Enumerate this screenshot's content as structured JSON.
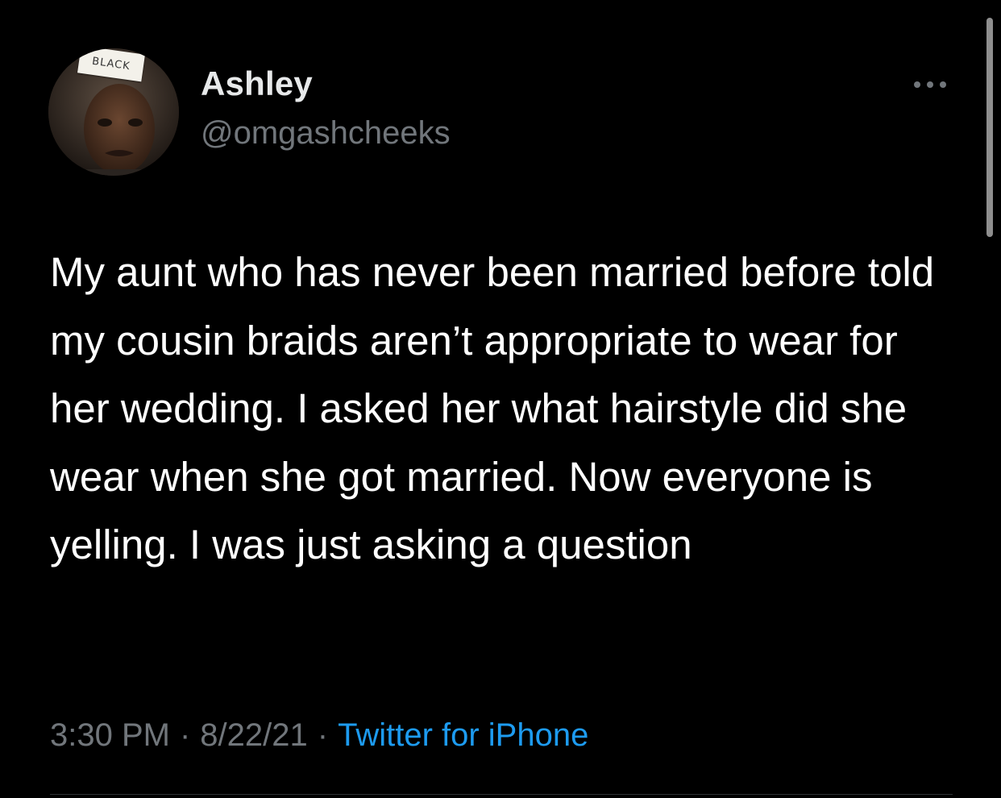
{
  "author": {
    "name": "Ashley",
    "handle": "@omgashcheeks",
    "avatar_label": "BLACK"
  },
  "tweet": {
    "text": "My aunt who has never been married before told my cousin braids aren’t appropriate to wear for her wedding. I asked her what hairstyle did she wear when she got married. Now everyone is yelling. I was just asking a question",
    "time": "3:30 PM",
    "date": "8/22/21",
    "source": "Twitter for iPhone",
    "separator": "·"
  },
  "icons": {
    "more": "more-horizontal-icon"
  },
  "colors": {
    "background": "#000000",
    "text": "#ffffff",
    "secondary": "#71767b",
    "accent": "#1d9bf0"
  }
}
